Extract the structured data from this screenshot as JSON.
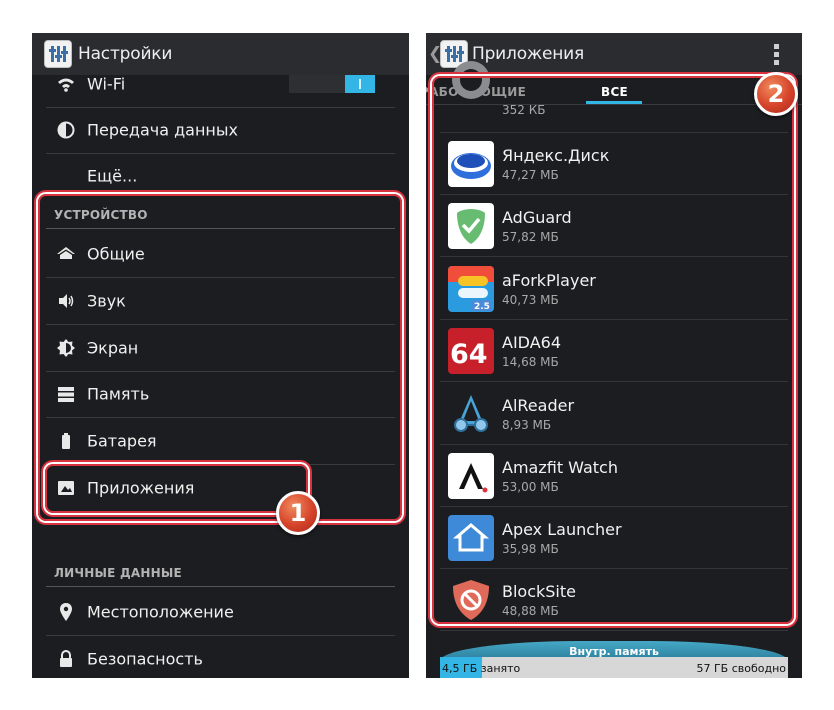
{
  "left_screen": {
    "title": "Настройки",
    "items_top": [
      {
        "label": "Wi-Fi",
        "icon": "wifi-icon"
      },
      {
        "label": "Передача данных",
        "icon": "data-usage-icon"
      },
      {
        "label": "Ещё...",
        "icon": ""
      }
    ],
    "device_section": {
      "header": "УСТРОЙСТВО",
      "items": [
        {
          "label": "Общие",
          "icon": "home-icon"
        },
        {
          "label": "Звук",
          "icon": "speaker-icon"
        },
        {
          "label": "Экран",
          "icon": "brightness-icon"
        },
        {
          "label": "Память",
          "icon": "storage-icon"
        },
        {
          "label": "Батарея",
          "icon": "battery-icon"
        },
        {
          "label": "Приложения",
          "icon": "apps-icon"
        }
      ]
    },
    "personal_section": {
      "header": "ЛИЧНЫЕ ДАННЫЕ",
      "items": [
        {
          "label": "Местоположение",
          "icon": "location-pin-icon"
        },
        {
          "label": "Безопасность",
          "icon": "lock-icon"
        }
      ]
    },
    "wifi_toggle": "on",
    "callout_number": "1"
  },
  "right_screen": {
    "title": "Приложения",
    "tabs": [
      {
        "label": "РАБОТАЮЩИЕ",
        "active": false
      },
      {
        "label": "ВСЕ",
        "active": true
      }
    ],
    "apps": [
      {
        "name": "",
        "size": "352 КБ",
        "icon": "gear-icon"
      },
      {
        "name": "Яндекс.Диск",
        "size": "47,27 МБ",
        "icon": "yandex-disk-icon"
      },
      {
        "name": "AdGuard",
        "size": "57,82 МБ",
        "icon": "adguard-shield-icon"
      },
      {
        "name": "aForkPlayer",
        "size": "40,73 МБ",
        "icon": "aforkplayer-icon"
      },
      {
        "name": "AIDA64",
        "size": "14,68 МБ",
        "icon": "aida64-icon"
      },
      {
        "name": "AlReader",
        "size": "8,93 МБ",
        "icon": "alreader-icon"
      },
      {
        "name": "Amazfit Watch",
        "size": "53,00 МБ",
        "icon": "amazfit-icon"
      },
      {
        "name": "Apex Launcher",
        "size": "35,98 МБ",
        "icon": "apex-launcher-icon"
      },
      {
        "name": "BlockSite",
        "size": "48,88 МБ",
        "icon": "blocksite-icon"
      }
    ],
    "storage": {
      "label": "Внутр. память",
      "used": "4,5 ГБ занято",
      "free": "57 ГБ свободно"
    },
    "callout_number": "2"
  },
  "colors": {
    "accent": "#33b5e5",
    "callout_red": "#d9333f",
    "background": "#1c1d20"
  }
}
